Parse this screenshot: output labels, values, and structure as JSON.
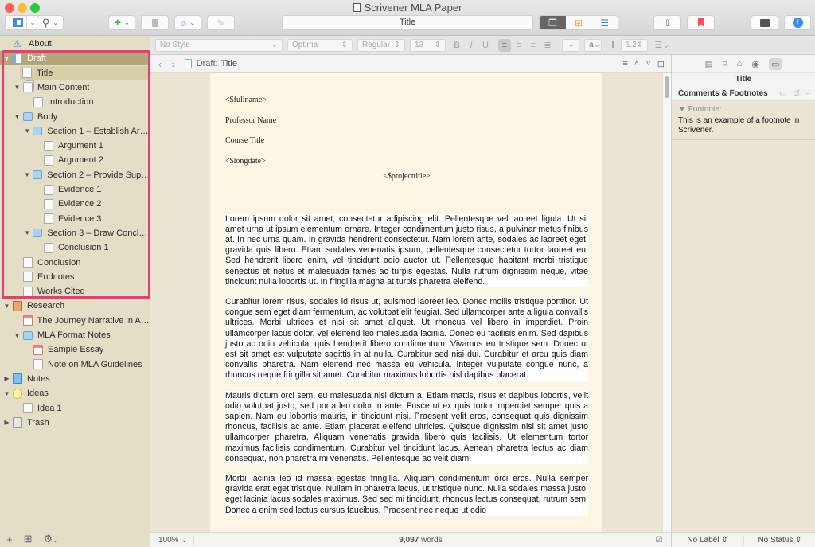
{
  "window": {
    "title": "Scrivener MLA Paper"
  },
  "toolbar": {
    "title_field": "Title",
    "buttons": {
      "view_mode": "layout-icon",
      "search": "search-icon",
      "add": "+",
      "trash": "trash-icon",
      "attach": "paperclip-icon",
      "compose": "edit-icon",
      "share": "share-icon",
      "bookmark": "bookmark-icon",
      "composition": "composition-mode-icon",
      "inspector": "i"
    },
    "view_segments": [
      "scrivenings",
      "corkboard",
      "outline"
    ]
  },
  "binder": {
    "items": [
      {
        "label": "About",
        "icon": "warning",
        "depth": 0,
        "toggle": ""
      },
      {
        "label": "Draft",
        "icon": "draft",
        "depth": 0,
        "toggle": "▼"
      },
      {
        "label": "Title",
        "icon": "doc",
        "depth": 1,
        "toggle": ""
      },
      {
        "label": "Main Content",
        "icon": "stack",
        "depth": 1,
        "toggle": "▼"
      },
      {
        "label": "Introduction",
        "icon": "doc",
        "depth": 2,
        "toggle": ""
      },
      {
        "label": "Body",
        "icon": "folder",
        "depth": 1,
        "toggle": "▼"
      },
      {
        "label": "Section 1 – Establish Argu…",
        "icon": "folder",
        "depth": 2,
        "toggle": "▼"
      },
      {
        "label": "Argument 1",
        "icon": "doc",
        "depth": 3,
        "toggle": ""
      },
      {
        "label": "Argument 2",
        "icon": "doc",
        "depth": 3,
        "toggle": ""
      },
      {
        "label": "Section 2 – Provide Suppo…",
        "icon": "folder",
        "depth": 2,
        "toggle": "▼"
      },
      {
        "label": "Evidence 1",
        "icon": "doc",
        "depth": 3,
        "toggle": ""
      },
      {
        "label": "Evidence 2",
        "icon": "doc",
        "depth": 3,
        "toggle": ""
      },
      {
        "label": "Evidence 3",
        "icon": "doc",
        "depth": 3,
        "toggle": ""
      },
      {
        "label": "Section 3 – Draw Conclusi…",
        "icon": "folder",
        "depth": 2,
        "toggle": "▼"
      },
      {
        "label": "Conclusion 1",
        "icon": "doc",
        "depth": 3,
        "toggle": ""
      },
      {
        "label": "Conclusion",
        "icon": "doc",
        "depth": 1,
        "toggle": ""
      },
      {
        "label": "Endnotes",
        "icon": "doc",
        "depth": 1,
        "toggle": ""
      },
      {
        "label": "Works Cited",
        "icon": "doc",
        "depth": 1,
        "toggle": ""
      },
      {
        "label": "Research",
        "icon": "research",
        "depth": 0,
        "toggle": "▼"
      },
      {
        "label": "The Journey Narrative in Am…",
        "icon": "pdf",
        "depth": 1,
        "toggle": ""
      },
      {
        "label": "MLA Format Notes",
        "icon": "folder",
        "depth": 1,
        "toggle": "▼"
      },
      {
        "label": "Eample Essay",
        "icon": "pdf",
        "depth": 2,
        "toggle": ""
      },
      {
        "label": "Note on MLA Guidelines",
        "icon": "doc",
        "depth": 2,
        "toggle": ""
      },
      {
        "label": "Notes",
        "icon": "notebook",
        "depth": 0,
        "toggle": "▶"
      },
      {
        "label": "Ideas",
        "icon": "bulb",
        "depth": 0,
        "toggle": "▼"
      },
      {
        "label": "Idea 1",
        "icon": "doc",
        "depth": 1,
        "toggle": ""
      },
      {
        "label": "Trash",
        "icon": "trash",
        "depth": 0,
        "toggle": "▶"
      }
    ],
    "selected": "Title",
    "footer": {
      "add": "+",
      "add_folder": "⊞",
      "settings": "⚙"
    }
  },
  "format_bar": {
    "style": "No Style",
    "font": "Optima",
    "weight": "Regular",
    "size": "13",
    "bold": "B",
    "italic": "I",
    "underline": "U",
    "text_color": "",
    "highlight": "a",
    "line_spacing": "1.2"
  },
  "editor": {
    "header": {
      "path_prefix": "Draft:",
      "doc_title": "Title"
    },
    "title_page": {
      "fullname": "<$fullname>",
      "professor": "Professor Name",
      "course": "Course Title",
      "date": "<$longdate>",
      "project_title": "<$projecttitle>"
    },
    "paragraphs": [
      "Lorem ipsum dolor sit amet, consectetur adipiscing elit. Pellentesque vel laoreet ligula. Ut sit amet urna ut ipsum elementum ornare. Integer condimentum justo risus, a pulvinar metus finibus at. In nec urna quam. In gravida hendrerit consectetur. Nam lorem ante, sodales ac laoreet eget, gravida quis libero. Etiam sodales venenatis ipsum, pellentesque consectetur tortor laoreet eu. Sed hendrerit libero enim, vel tincidunt odio auctor ut. Pellentesque habitant morbi tristique senectus et netus et malesuada fames ac turpis egestas. Nulla rutrum dignissim neque, vitae tincidunt nulla lobortis ut. In fringilla magna at turpis pharetra eleifend.",
      "Curabitur lorem risus, sodales id risus ut, euismod laoreet leo. Donec mollis tristique porttitor. Ut congue sem eget diam fermentum, ac volutpat elit feugiat. Sed ullamcorper ante a ligula convallis ultrices. Morbi ultrices et nisi sit amet aliquet. Ut rhoncus vel libero in imperdiet. Proin ullamcorper lacus dolor, vel eleifend leo malesuada lacinia. Donec eu facilisis enim. Sed dapibus justo ac odio vehicula, quis hendrerit libero condimentum. Vivamus eu tristique sem. Donec ut est sit amet est vulputate sagittis in at nulla. Curabitur sed nisi dui. Curabitur et arcu quis diam convallis pharetra. Nam eleifend nec massa eu vehicula. Integer vulputate congue nunc, a rhoncus neque fringilla sit amet. Curabitur maximus lobortis nisl dapibus placerat.",
      "Mauris dictum orci sem, eu malesuada nisl dictum a. Etiam mattis, risus et dapibus lobortis, velit odio volutpat justo, sed porta leo dolor in ante. Fusce ut ex quis tortor imperdiet semper quis a sapien. Nam eu lobortis mauris, in tincidunt nisi. Praesent velit eros, consequat quis dignissim rhoncus, facilisis ac ante. Etiam placerat eleifend ultricies. Quisque dignissim nisl sit amet justo ullamcorper pharetra. Aliquam venenatis gravida libero quis facilisis. Ut elementum tortor maximus facilisis condimentum. Curabitur vel tincidunt lacus. Aenean pharetra lectus ac diam consequat, non pharetra mi venenatis. Pellentesque ac velit diam.",
      "Morbi lacinia leo id massa egestas fringilla. Aliquam condimentum orci eros. Nulla semper gravida erat eget tristique. Nullam in pharetra lacus, ut tristique nunc. Nulla sodales massa justo, eget lacinia lacus sodales maximus. Sed sed mi tincidunt, rhoncus lectus consequat, rutrum sem. Donec a enim sed lectus cursus faucibus. Praesent nec neque ut odio"
    ],
    "footer": {
      "zoom": "100%",
      "word_count": "9,097",
      "word_label": "words"
    }
  },
  "inspector": {
    "doc_title": "Title",
    "section_title": "Comments & Footnotes",
    "comment_tool": "comment",
    "footnote_tool": "cf",
    "remove_tool": "–",
    "footnote": {
      "header": "Footnote:",
      "text": "This is an example of a footnote in Scrivener."
    },
    "label": "No Label",
    "status": "No Status"
  }
}
